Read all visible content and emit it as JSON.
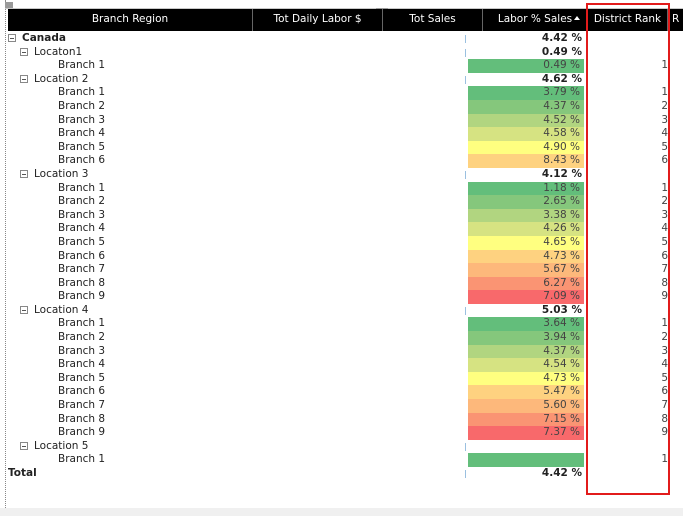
{
  "columns": [
    {
      "label": "Branch Region"
    },
    {
      "label": "Tot Daily Labor $"
    },
    {
      "label": "Tot Sales"
    },
    {
      "label": "Labor % Sales"
    },
    {
      "label": "District Rank"
    },
    {
      "label": "R"
    }
  ],
  "colors": {
    "header_bg": "#000000",
    "highlight_border": "#e21b1b",
    "scale": [
      "#63be7b",
      "#85c77c",
      "#b1d580",
      "#d6e382",
      "#ffeb84",
      "#fed280",
      "#fdb87b",
      "#fa9473",
      "#f8696b"
    ]
  },
  "rows": [
    {
      "level": 0,
      "type": "group",
      "label": "Canada",
      "pct": "4.42 %",
      "rank": ""
    },
    {
      "level": 1,
      "type": "group",
      "label": "Locaton1",
      "pct": "0.49 %",
      "rank": ""
    },
    {
      "level": 2,
      "type": "leaf",
      "label": "Branch 1",
      "pct": "0.49 %",
      "rank": "1",
      "color": "#63be7b"
    },
    {
      "level": 1,
      "type": "group",
      "label": "Location 2",
      "pct": "4.62 %",
      "rank": ""
    },
    {
      "level": 2,
      "type": "leaf",
      "label": "Branch 1",
      "pct": "3.79 %",
      "rank": "1",
      "color": "#63be7b"
    },
    {
      "level": 2,
      "type": "leaf",
      "label": "Branch 2",
      "pct": "4.37 %",
      "rank": "2",
      "color": "#85c77c"
    },
    {
      "level": 2,
      "type": "leaf",
      "label": "Branch 3",
      "pct": "4.52 %",
      "rank": "3",
      "color": "#b1d580"
    },
    {
      "level": 2,
      "type": "leaf",
      "label": "Branch 4",
      "pct": "4.58 %",
      "rank": "4",
      "color": "#d6e382"
    },
    {
      "level": 2,
      "type": "leaf",
      "label": "Branch 5",
      "pct": "4.90 %",
      "rank": "5",
      "color": "#ffff80"
    },
    {
      "level": 2,
      "type": "leaf",
      "label": "Branch 6",
      "pct": "8.43 %",
      "rank": "6",
      "color": "#fed280"
    },
    {
      "level": 1,
      "type": "group",
      "label": "Location 3",
      "pct": "4.12 %",
      "rank": ""
    },
    {
      "level": 2,
      "type": "leaf",
      "label": "Branch 1",
      "pct": "1.18 %",
      "rank": "1",
      "color": "#63be7b"
    },
    {
      "level": 2,
      "type": "leaf",
      "label": "Branch 2",
      "pct": "2.65 %",
      "rank": "2",
      "color": "#85c77c"
    },
    {
      "level": 2,
      "type": "leaf",
      "label": "Branch 3",
      "pct": "3.38 %",
      "rank": "3",
      "color": "#b1d580"
    },
    {
      "level": 2,
      "type": "leaf",
      "label": "Branch 4",
      "pct": "4.26 %",
      "rank": "4",
      "color": "#d6e382"
    },
    {
      "level": 2,
      "type": "leaf",
      "label": "Branch 5",
      "pct": "4.65 %",
      "rank": "5",
      "color": "#ffff80"
    },
    {
      "level": 2,
      "type": "leaf",
      "label": "Branch 6",
      "pct": "4.73 %",
      "rank": "6",
      "color": "#fed280"
    },
    {
      "level": 2,
      "type": "leaf",
      "label": "Branch 7",
      "pct": "5.67 %",
      "rank": "7",
      "color": "#fdb87b"
    },
    {
      "level": 2,
      "type": "leaf",
      "label": "Branch 8",
      "pct": "6.27 %",
      "rank": "8",
      "color": "#fa9473"
    },
    {
      "level": 2,
      "type": "leaf",
      "label": "Branch 9",
      "pct": "7.09 %",
      "rank": "9",
      "color": "#f8696b"
    },
    {
      "level": 1,
      "type": "group",
      "label": "Location 4",
      "pct": "5.03 %",
      "rank": ""
    },
    {
      "level": 2,
      "type": "leaf",
      "label": "Branch 1",
      "pct": "3.64 %",
      "rank": "1",
      "color": "#63be7b"
    },
    {
      "level": 2,
      "type": "leaf",
      "label": "Branch 2",
      "pct": "3.94 %",
      "rank": "2",
      "color": "#85c77c"
    },
    {
      "level": 2,
      "type": "leaf",
      "label": "Branch 3",
      "pct": "4.37 %",
      "rank": "3",
      "color": "#b1d580"
    },
    {
      "level": 2,
      "type": "leaf",
      "label": "Branch 4",
      "pct": "4.54 %",
      "rank": "4",
      "color": "#d6e382"
    },
    {
      "level": 2,
      "type": "leaf",
      "label": "Branch 5",
      "pct": "4.73 %",
      "rank": "5",
      "color": "#ffff80"
    },
    {
      "level": 2,
      "type": "leaf",
      "label": "Branch 6",
      "pct": "5.47 %",
      "rank": "6",
      "color": "#fed280"
    },
    {
      "level": 2,
      "type": "leaf",
      "label": "Branch 7",
      "pct": "5.60 %",
      "rank": "7",
      "color": "#fdb87b"
    },
    {
      "level": 2,
      "type": "leaf",
      "label": "Branch 8",
      "pct": "7.15 %",
      "rank": "8",
      "color": "#fa9473"
    },
    {
      "level": 2,
      "type": "leaf",
      "label": "Branch 9",
      "pct": "7.37 %",
      "rank": "9",
      "color": "#f8696b"
    },
    {
      "level": 1,
      "type": "group",
      "label": "Location 5",
      "pct": "",
      "rank": ""
    },
    {
      "level": 2,
      "type": "leaf",
      "label": "Branch 1",
      "pct": "",
      "rank": "1",
      "color": "#63be7b"
    },
    {
      "level": 0,
      "type": "total",
      "label": "Total",
      "pct": "4.42 %",
      "rank": ""
    }
  ]
}
